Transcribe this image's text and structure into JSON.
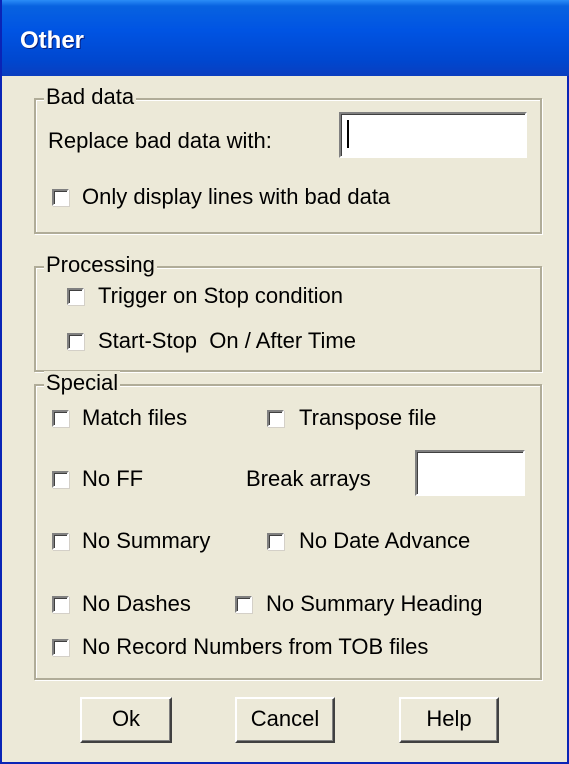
{
  "window": {
    "title": "Other"
  },
  "bad_data": {
    "group_label": "Bad data",
    "replace_label": "Replace bad data with:",
    "replace_value": "",
    "only_display_label": "Only display lines with bad data",
    "only_display_checked": false
  },
  "processing": {
    "group_label": "Processing",
    "trigger_label": "Trigger on Stop condition",
    "trigger_checked": false,
    "start_stop_label": "Start-Stop  On / After Time",
    "start_stop_checked": false
  },
  "special": {
    "group_label": "Special",
    "match_files_label": "Match files",
    "transpose_file_label": "Transpose file",
    "no_ff_label": "No FF",
    "break_arrays_label": "Break arrays",
    "break_arrays_value": "",
    "no_summary_label": "No Summary",
    "no_date_advance_label": "No Date Advance",
    "no_dashes_label": "No Dashes",
    "no_summary_heading_label": "No Summary Heading",
    "no_record_numbers_label": "No Record Numbers from TOB files"
  },
  "buttons": {
    "ok": "Ok",
    "cancel": "Cancel",
    "help": "Help"
  }
}
